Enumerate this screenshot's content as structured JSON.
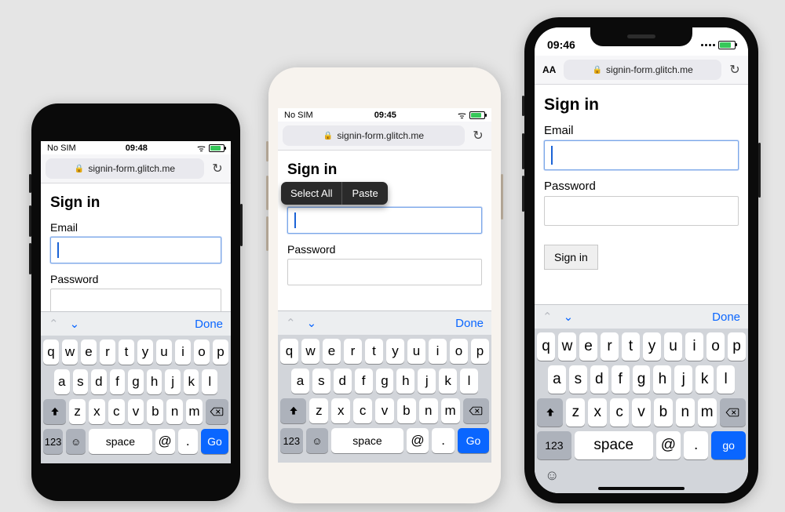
{
  "url_host": "signin-form.glitch.me",
  "form": {
    "title": "Sign in",
    "email_label": "Email",
    "password_label": "Password",
    "submit_label": "Sign in"
  },
  "context_menu": {
    "select_all": "Select All",
    "paste": "Paste"
  },
  "keyboard": {
    "row1": [
      "q",
      "w",
      "e",
      "r",
      "t",
      "y",
      "u",
      "i",
      "o",
      "p"
    ],
    "row2": [
      "a",
      "s",
      "d",
      "f",
      "g",
      "h",
      "j",
      "k",
      "l"
    ],
    "row3": [
      "z",
      "x",
      "c",
      "v",
      "b",
      "n",
      "m"
    ],
    "num_key": "123",
    "space_key": "space",
    "at_key": "@",
    "dot_key": ".",
    "go_key_upper": "Go",
    "go_key_lower": "go",
    "done": "Done",
    "aa": "AA"
  },
  "phones": {
    "p1": {
      "status_left": "No SIM",
      "time": "09:48"
    },
    "p2": {
      "status_left": "No SIM",
      "time": "09:45"
    },
    "p3": {
      "time": "09:46"
    }
  }
}
